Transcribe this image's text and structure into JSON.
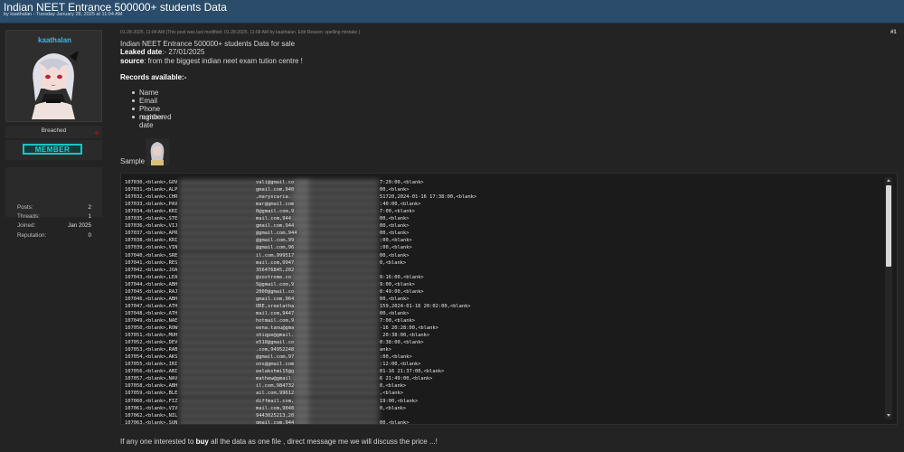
{
  "thread": {
    "title": "Indian NEET Entrance 500000+ students Data",
    "subtitle": "by kaathalan - Tuesday January 28, 2025 at 11:04 AM"
  },
  "user": {
    "name": "kaathalan",
    "status": "Breached",
    "rank": "MEMBER",
    "stats": [
      {
        "label": "Posts:",
        "value": "2"
      },
      {
        "label": "Threads:",
        "value": "1"
      },
      {
        "label": "Joined:",
        "value": "Jan 2025"
      },
      {
        "label": "Reputation:",
        "value": "0"
      }
    ]
  },
  "post": {
    "meta": "01-28-2025, 11:04 AM  (This post was last modified: 01-28-2025, 11:09 AM by kaathalan. Edit Reason: spelling mistake )",
    "number": "#1",
    "intro": "Indian NEET Entrance 500000+ students Data for sale",
    "leaked_label": "Leaked date",
    "leaked_value": ":- 27/01/2025",
    "source_label": "source",
    "source_value": ": from the biggest indian neet exam tution centre !",
    "records_heading": "Records available:-",
    "records": [
      "Name",
      "Email",
      "Phone number",
      "registered date"
    ],
    "sample_label": "Sample",
    "footer_prefix": "If any one interested to ",
    "footer_bold": "buy",
    "footer_suffix": " all the data as one file , direct message me  we will discuss the price ...!"
  },
  "code": {
    "lines": [
      {
        "a": "107030,<blank>,GOV",
        "b": "vali@gmail.co",
        "c": "7:20:00,<blank>"
      },
      {
        "a": "107031,<blank>,ALP",
        "b": "gmail.com,940",
        "c": "00,<blank>"
      },
      {
        "a": "107032,<blank>,CHR",
        "b": ",maryscaria.",
        "c": "51720,2024-01-16 17:38:00,<blank>"
      },
      {
        "a": "107033,<blank>,PAV",
        "b": "mar@gmail.com",
        "c": ":40:00,<blank>"
      },
      {
        "a": "107034,<blank>,KRI",
        "b": "0@gmail.com,9",
        "c": "7:00,<blank>"
      },
      {
        "a": "107035,<blank>,STE",
        "b": "mail.com,944",
        "c": "00,<blank>"
      },
      {
        "a": "107036,<blank>,VIJ",
        "b": "gmail.com,944",
        "c": "00,<blank>"
      },
      {
        "a": "107037,<blank>,APR",
        "b": "@gmail.com,944",
        "c": "00,<blank>"
      },
      {
        "a": "107038,<blank>,KRI",
        "b": "@gmail.com,99",
        "c": ":00,<blank>"
      },
      {
        "a": "107039,<blank>,VIN",
        "b": "@gmail.com,96",
        "c": ":00,<blank>"
      },
      {
        "a": "107040,<blank>,SRE",
        "b": "il.com,999517",
        "c": "00,<blank>"
      },
      {
        "a": "107041,<blank>,RES",
        "b": "mail.com,9947",
        "c": "0,<blank>"
      },
      {
        "a": "107042,<blank>,JOA",
        "b": "356476845,202",
        "c": ""
      },
      {
        "a": "107043,<blank>,LEA",
        "b": "@vostrome.co",
        "c": "9:16:00,<blank>"
      },
      {
        "a": "107044,<blank>,ABH",
        "b": "5@gmail.com,9",
        "c": "9:00,<blank>"
      },
      {
        "a": "107045,<blank>,RAJ",
        "b": "2000@gmail.co",
        "c": "0:49:00,<blank>"
      },
      {
        "a": "107046,<blank>,ABH",
        "b": "gmail.com,964",
        "c": "00,<blank>"
      },
      {
        "a": "107047,<blank>,ATH",
        "b": "ORE,sreelatha",
        "c": "159,2024-01-16 20:02:00,<blank>"
      },
      {
        "a": "107048,<blank>,ATH",
        "b": "mail.com,9447",
        "c": "00,<blank>"
      },
      {
        "a": "107049,<blank>,NAE",
        "b": "hotmail.com,9",
        "c": "7:00,<blank>"
      },
      {
        "a": "107050,<blank>,ROW",
        "b": "eena.tanu@gma",
        "c": "-16 20:28:00,<blank>"
      },
      {
        "a": "107051,<blank>,MUH",
        "b": "shiqpe@gmail.",
        "c": " 20:38:00,<blank>"
      },
      {
        "a": "107052,<blank>,DEV",
        "b": "e518@gmail.co",
        "c": "0:38:00,<blank>"
      },
      {
        "a": "107053,<blank>,RAB",
        "b": ".com,94952248",
        "c": "ank>"
      },
      {
        "a": "107054,<blank>,AKS",
        "b": "@gmail.com,97",
        "c": ":00,<blank>"
      },
      {
        "a": "107055,<blank>,IRI",
        "b": "ons@gmail.com",
        "c": ":12:00,<blank>"
      },
      {
        "a": "107056,<blank>,ABI",
        "b": "eelakshmi15@g",
        "c": "01-16 21:37:00,<blank>"
      },
      {
        "a": "107057,<blank>,NAV",
        "b": "mathew@gmail",
        "c": "6 21:49:00,<blank>"
      },
      {
        "a": "107058,<blank>,ABH",
        "b": "il.com,984732",
        "c": "0,<blank>"
      },
      {
        "a": "107059,<blank>,BLE",
        "b": "ail.com,99612",
        "c": ",<blank>"
      },
      {
        "a": "107060,<blank>,FIZ",
        "b": "diffmail.com,",
        "c": "19:00,<blank>"
      },
      {
        "a": "107061,<blank>,VIV",
        "b": "mail.com,9048",
        "c": "0,<blank>"
      },
      {
        "a": "107062,<blank>,NIL",
        "b": "9443025213,20",
        "c": ""
      },
      {
        "a": "107063,<blank>,SUN",
        "b": "gmail.com,944",
        "c": "00,<blank>"
      }
    ]
  },
  "colors": {
    "topbar": "#2b4c6b",
    "username": "#46b3e6",
    "rank_badge": "#16c6c6",
    "status_dot": "#7a1e1e"
  }
}
